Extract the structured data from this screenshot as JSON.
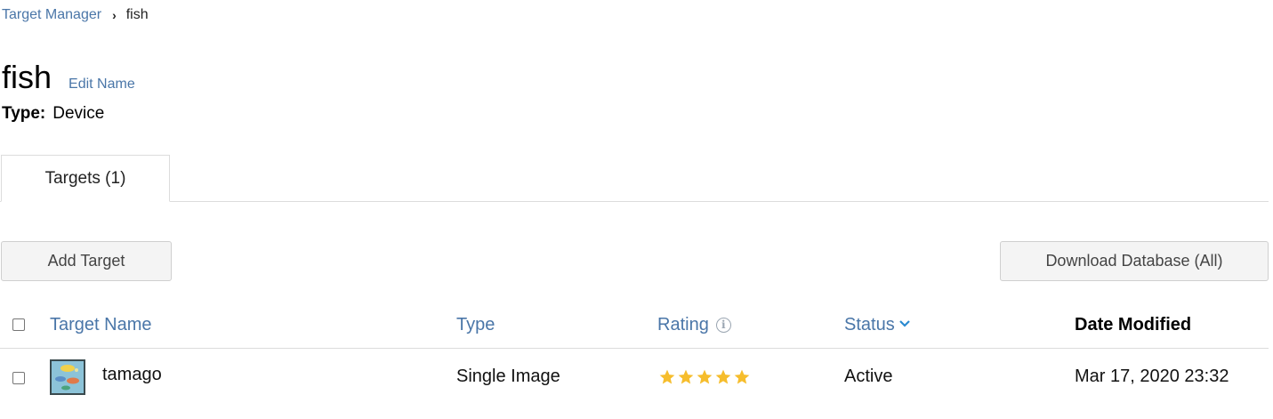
{
  "breadcrumb": {
    "parent": "Target Manager",
    "separator": "›",
    "current": "fish"
  },
  "header": {
    "title": "fish",
    "edit_label": "Edit Name",
    "type_label": "Type:",
    "type_value": "Device"
  },
  "tabs": [
    {
      "label": "Targets (1)",
      "active": true
    }
  ],
  "toolbar": {
    "add_label": "Add Target",
    "download_label": "Download Database (All)"
  },
  "table": {
    "columns": {
      "name": "Target Name",
      "type": "Type",
      "rating": "Rating",
      "status": "Status",
      "date": "Date Modified"
    },
    "rows": [
      {
        "name": "tamago",
        "type": "Single Image",
        "rating": 5,
        "rating_max": 5,
        "status": "Active",
        "date": "Mar 17, 2020 23:32"
      }
    ]
  },
  "colors": {
    "link": "#4a76a8",
    "star": "#f6bd2c",
    "border": "#dcdcdc",
    "button_bg": "#f4f4f4"
  },
  "icons": [
    "chevron-right-icon",
    "info-icon",
    "chevron-down-icon",
    "star-icon",
    "checkbox"
  ]
}
